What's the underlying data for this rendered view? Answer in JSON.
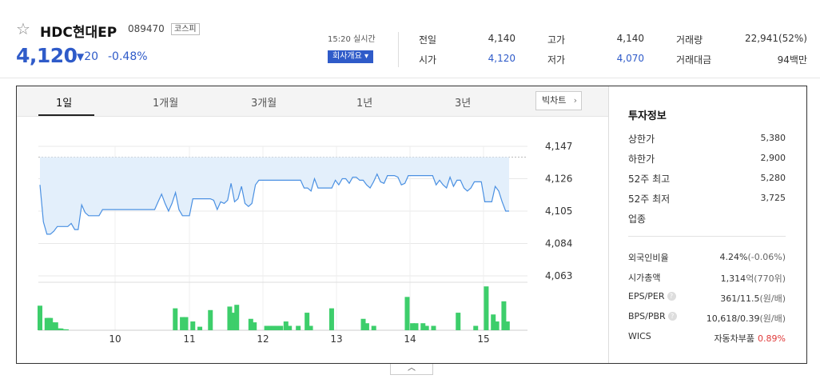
{
  "header": {
    "name": "HDC현대EP",
    "code": "089470",
    "market": "코스피",
    "price": "4,120",
    "change_arrow": "▼",
    "change": "20",
    "change_pct": "-0.48%",
    "time_label": "15:20 실시간",
    "company_button": "회사개요 ▾",
    "stats": {
      "prev_close_label": "전일",
      "prev_close": "4,140",
      "open_label": "시가",
      "open": "4,120",
      "high_label": "고가",
      "high": "4,140",
      "low_label": "저가",
      "low": "4,070",
      "volume_label": "거래량",
      "volume": "22,941(52%)",
      "amount_label": "거래대금",
      "amount": "94백만"
    }
  },
  "tabs": [
    "1일",
    "1개월",
    "3개월",
    "1년",
    "3년"
  ],
  "big_chart_label": "빅차트",
  "colors": {
    "price_blue": "#2f5bc9",
    "up_red": "#e03a3a",
    "line": "#4a90e2",
    "fill": "#e3effb",
    "bar": "#3dce6b"
  },
  "chart_data": {
    "type": "line",
    "y_ticks": [
      "4,147",
      "4,126",
      "4,105",
      "4,084",
      "4,063"
    ],
    "ylim": [
      4063,
      4147
    ],
    "prev_close": 4140,
    "x_ticks": [
      "10",
      "11",
      "12",
      "13",
      "14",
      "15"
    ],
    "price": [
      4122,
      4098,
      4090,
      4090,
      4092,
      4095,
      4095,
      4095,
      4095,
      4097,
      4093,
      4093,
      4109,
      4104,
      4102,
      4102,
      4102,
      4102,
      4106,
      4106,
      4106,
      4106,
      4106,
      4106,
      4106,
      4106,
      4106,
      4106,
      4106,
      4106,
      4106,
      4106,
      4106,
      4106,
      4111,
      4116,
      4110,
      4105,
      4110,
      4117,
      4106,
      4102,
      4102,
      4102,
      4113,
      4113,
      4113,
      4113,
      4113,
      4113,
      4112,
      4106,
      4111,
      4110,
      4112,
      4123,
      4111,
      4113,
      4121,
      4110,
      4108,
      4110,
      4122,
      4125,
      4125,
      4125,
      4125,
      4125,
      4125,
      4125,
      4125,
      4125,
      4125,
      4125,
      4125,
      4125,
      4120,
      4120,
      4118,
      4126,
      4120,
      4120,
      4120,
      4120,
      4120,
      4125,
      4122,
      4126,
      4126,
      4123,
      4127,
      4127,
      4125,
      4125,
      4122,
      4120,
      4124,
      4129,
      4124,
      4123,
      4128,
      4128,
      4128,
      4127,
      4122,
      4123,
      4128,
      4128,
      4128,
      4128,
      4128,
      4128,
      4128,
      4128,
      4122,
      4125,
      4122,
      4120,
      4127,
      4121,
      4125,
      4125,
      4120,
      4118,
      4120,
      4124,
      4124,
      4124,
      4111,
      4111,
      4111,
      4121,
      4118,
      4111,
      4105,
      4105
    ],
    "volume": [
      28,
      0,
      0,
      0,
      14,
      14,
      14,
      9,
      2,
      9,
      2,
      2,
      2,
      1,
      1,
      1,
      0,
      0,
      0,
      0,
      0,
      0,
      0,
      0,
      0,
      0,
      0,
      0,
      0,
      0,
      0,
      0,
      0,
      0,
      0,
      0,
      0,
      0,
      0,
      0,
      0,
      0,
      0,
      0,
      0,
      0,
      0,
      0,
      0,
      0,
      0,
      0,
      0,
      0,
      0,
      0,
      0,
      0,
      0,
      0,
      0,
      0,
      0,
      0,
      0,
      0,
      0,
      0,
      0,
      0,
      0,
      0,
      0,
      0,
      0,
      0,
      0,
      25,
      0,
      0,
      0,
      15,
      0,
      15,
      0,
      0,
      0,
      10,
      0,
      0,
      0,
      4,
      0,
      0,
      0,
      0,
      0,
      23,
      0,
      0,
      0,
      0,
      0,
      0,
      0,
      0,
      0,
      0,
      27,
      0,
      20,
      0,
      29,
      0,
      0,
      0,
      0,
      0,
      0,
      0,
      13,
      0,
      9,
      0,
      0,
      0,
      0,
      0,
      0,
      5,
      0,
      5,
      0,
      5,
      0,
      5,
      0,
      5,
      0,
      0,
      10,
      0,
      5,
      0,
      0,
      0,
      0,
      5,
      0,
      0,
      0,
      0,
      20,
      0,
      5,
      0,
      0,
      0,
      0,
      0,
      0,
      0,
      0,
      0,
      0,
      0,
      25,
      0,
      0,
      0,
      0,
      0,
      0,
      0,
      0,
      0,
      0,
      0,
      0,
      0,
      0,
      0,
      0,
      0,
      13,
      0,
      8,
      0,
      0,
      0,
      5,
      0,
      0,
      0,
      0,
      0,
      0,
      0,
      0,
      0,
      0,
      0,
      0,
      0,
      0,
      0,
      0,
      0,
      0,
      38,
      0,
      0,
      8,
      0,
      8,
      0,
      0,
      0,
      8,
      0,
      5,
      0,
      0,
      0,
      5,
      0,
      0,
      0,
      0,
      0,
      0,
      0,
      0,
      0,
      0,
      0,
      0,
      0,
      20,
      0,
      0,
      0,
      0,
      0,
      0,
      0,
      0,
      0,
      5,
      0,
      0,
      0,
      0,
      0,
      50,
      0,
      0,
      0,
      18,
      0,
      10,
      0,
      0,
      0,
      33,
      0,
      10,
      0
    ]
  },
  "invest": {
    "title": "투자정보",
    "rows": [
      {
        "label": "상한가",
        "value": "5,380",
        "color": "red"
      },
      {
        "label": "하한가",
        "value": "2,900",
        "color": "blue"
      },
      {
        "label": "52주 최고",
        "value": "5,280",
        "color": ""
      },
      {
        "label": "52주 최저",
        "value": "3,725",
        "color": ""
      },
      {
        "label": "업종",
        "value": "",
        "color": ""
      }
    ],
    "rows2": [
      {
        "label": "외국인비율",
        "value": "4.24%",
        "suffix": "(-0.06%)",
        "q": false
      },
      {
        "label": "시가총액",
        "value": "1,314",
        "suffix": "억(770위)",
        "q": false
      },
      {
        "label": "EPS/PER",
        "value": "361/11.5",
        "suffix": "(원/배)",
        "q": true
      },
      {
        "label": "BPS/PBR",
        "value": "10,618/0.39",
        "suffix": "(원/배)",
        "q": true
      },
      {
        "label": "WICS",
        "value": "자동차부품",
        "suffix": "0.89%",
        "q": false
      }
    ]
  },
  "collapse_icon": "︿"
}
